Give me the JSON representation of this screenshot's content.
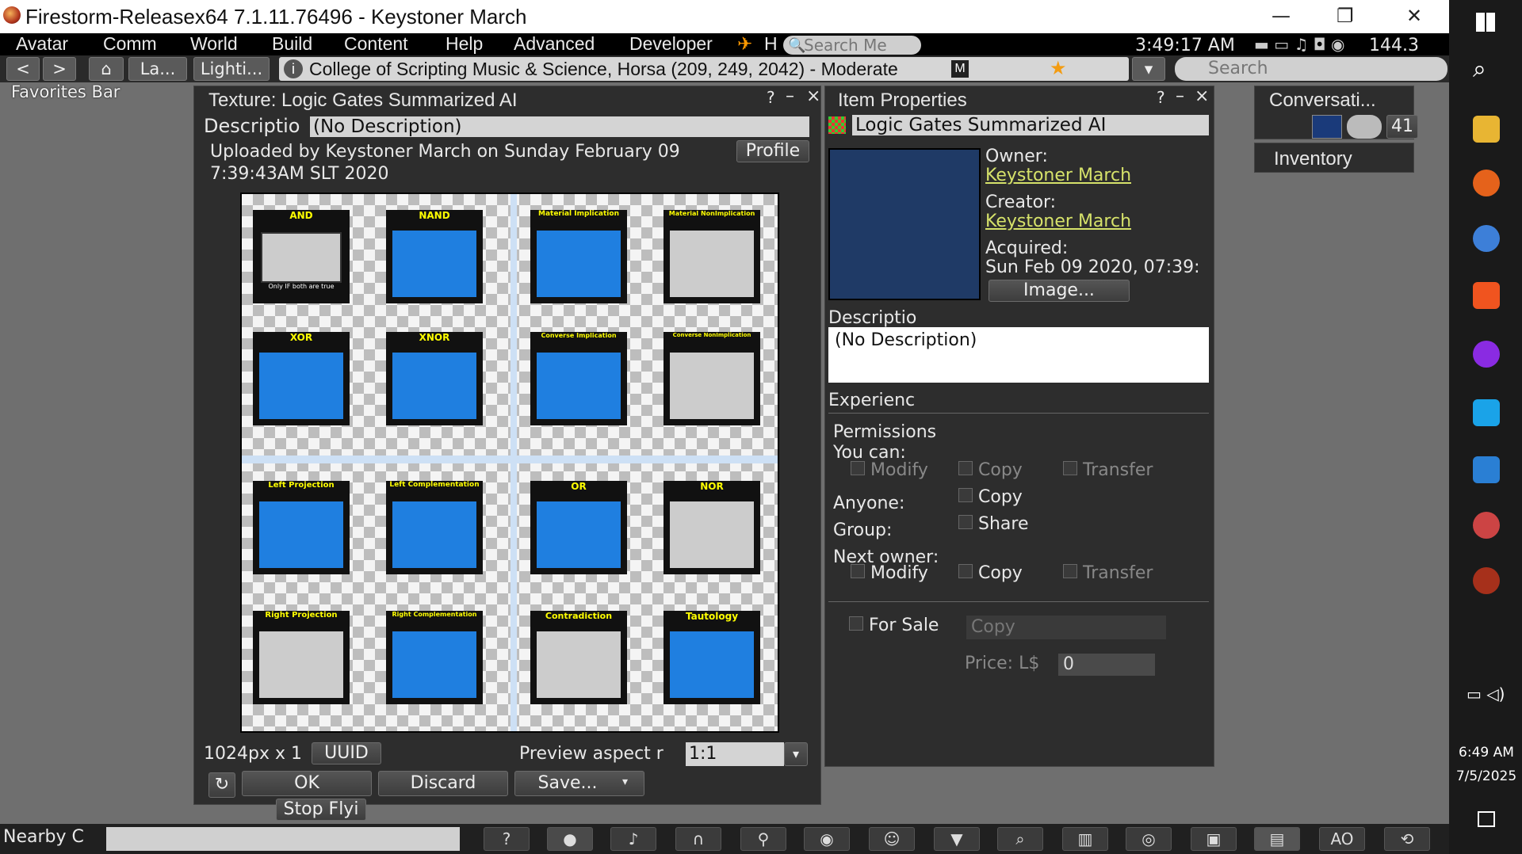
{
  "window": {
    "title": "Firestorm-Releasex64 7.1.11.76496 - Keystoner March",
    "min": "—",
    "max": "❐",
    "close": "✕"
  },
  "menu": {
    "items": [
      "Avatar",
      "Comm",
      "World",
      "Build",
      "Content",
      "Help",
      "Advanced",
      "Developer"
    ],
    "h_label": "H",
    "search_placeholder": "Search Me",
    "clock": "3:49:17 AM",
    "fps": "144.3"
  },
  "nav": {
    "back": "<",
    "fwd": ">",
    "home": "⌂",
    "btn1": "La...",
    "btn2": "Lighti...",
    "location": "College of Scripting Music & Science, Horsa (209, 249, 2042) - Moderate",
    "maturity": "M",
    "search_placeholder": "Search"
  },
  "favorites": "Favorites Bar",
  "texture": {
    "title": "Texture: Logic Gates Summarized AI",
    "help": "?",
    "min": "–",
    "close": "×",
    "desc_label": "Descriptio",
    "desc_value": "(No Description)",
    "uploaded": "Uploaded by Keystoner March on Sunday February 09",
    "uploaded2": "7:39:43AM SLT 2020",
    "profile": "Profile",
    "size_label": "1024px x 1",
    "uuid": "UUID",
    "aspect_label": "Preview aspect r",
    "aspect_value": "1:1",
    "ok": "OK",
    "discard": "Discard",
    "save": "Save...",
    "stopfly": "Stop Flyi"
  },
  "gates": {
    "q1": [
      "AND",
      "NAND",
      "XOR",
      "XNOR"
    ],
    "q2": [
      "Material Implication",
      "Material NonImplication",
      "Converse Implication",
      "Converse NonImplication"
    ],
    "q3": [
      "Left Projection",
      "Left Complementation",
      "Right Projection",
      "Right Complementation"
    ],
    "q4": [
      "OR",
      "NOR",
      "Contradiction",
      "Tautology"
    ],
    "note": "Only IF both are true"
  },
  "item": {
    "title": "Item Properties",
    "help": "?",
    "min": "–",
    "close": "×",
    "name": "Logic Gates Summarized AI",
    "owner_label": "Owner:",
    "owner": "Keystoner March",
    "creator_label": "Creator:",
    "creator": "Keystoner March",
    "acquired_label": "Acquired:",
    "acquired": "Sun Feb 09 2020, 07:39:",
    "image_btn": "Image...",
    "desc_label": "Descriptio",
    "desc": "(No Description)",
    "exp_label": "Experienc",
    "perm_label": "Permissions",
    "youcan": "You can:",
    "modify": "Modify",
    "copy": "Copy",
    "transfer": "Transfer",
    "anyone": "Anyone:",
    "group": "Group:",
    "share": "Share",
    "nextowner": "Next owner:",
    "forsale": "For Sale",
    "sale_type": "Copy",
    "price_label": "Price: L$",
    "price": "0"
  },
  "conv": {
    "title": "Conversati...",
    "count": "41"
  },
  "inventory": {
    "title": "Inventory"
  },
  "chat": {
    "label": "Nearby C"
  },
  "bottom": {
    "ao": "AO"
  },
  "taskbar": {
    "time": "6:49 AM",
    "date": "7/5/2025"
  }
}
